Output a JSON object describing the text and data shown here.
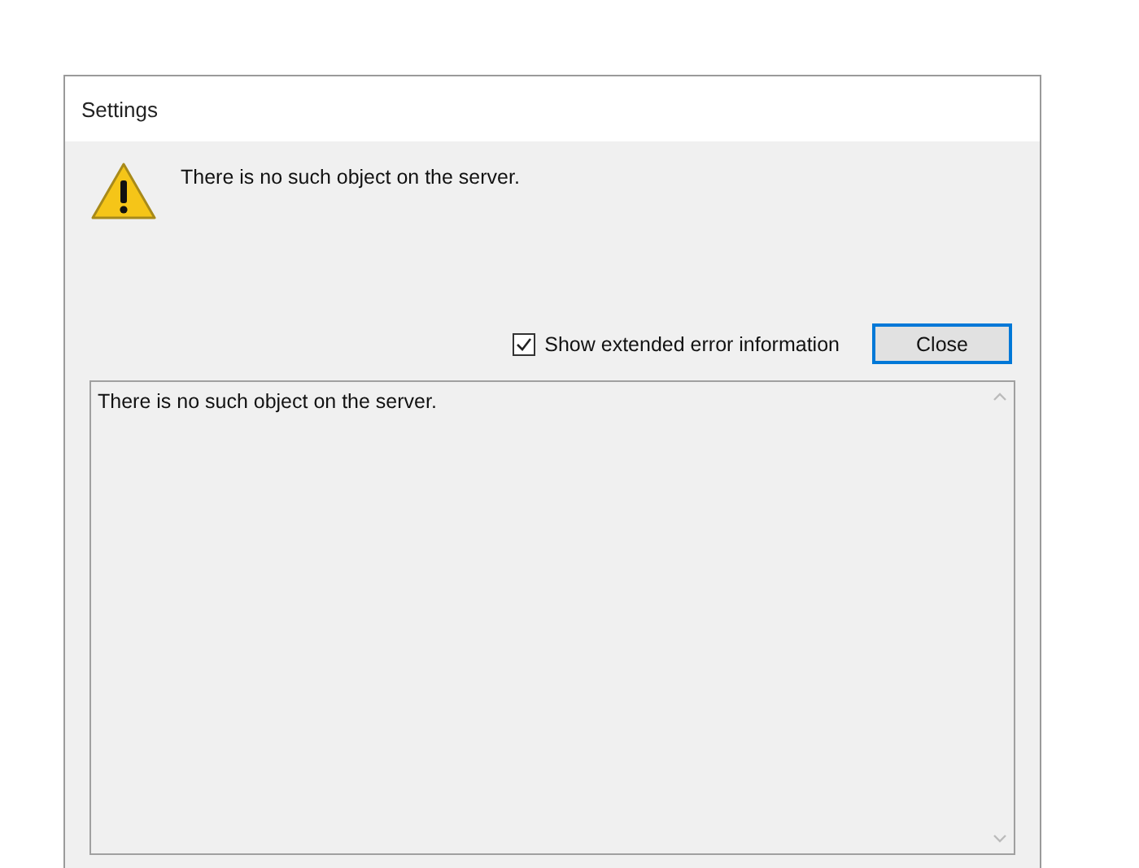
{
  "window": {
    "title": "Settings"
  },
  "message": "There is no such object on the server.",
  "show_details": {
    "label": "Show extended error information",
    "checked": true
  },
  "buttons": [
    "Close"
  ],
  "details": {
    "value": "There is no such object on the server."
  }
}
